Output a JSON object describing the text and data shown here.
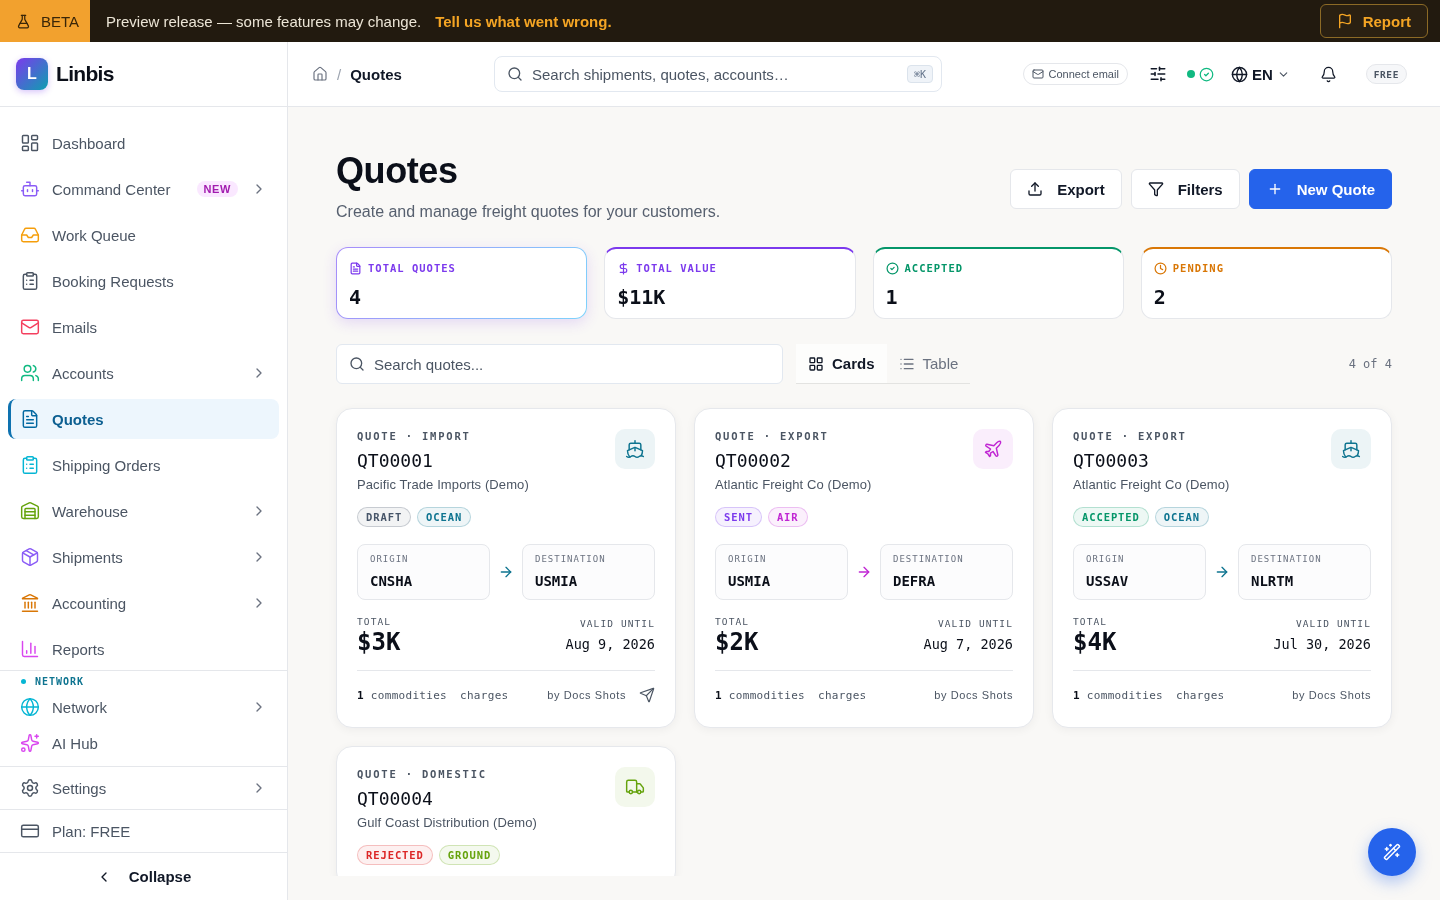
{
  "banner": {
    "badge": "BETA",
    "message": "Preview release — some features may change.",
    "link": "Tell us what went wrong.",
    "button": "Report"
  },
  "sidebar": {
    "brand": {
      "logo_letter": "L",
      "name": "Linbis"
    },
    "nav": [
      {
        "label": "Dashboard",
        "selected": false,
        "has_submenu": false
      },
      {
        "label": "Command Center",
        "selected": false,
        "has_submenu": true,
        "badge": "NEW"
      },
      {
        "label": "Work Queue",
        "selected": false,
        "has_submenu": false
      },
      {
        "label": "Booking Requests",
        "selected": false,
        "has_submenu": false
      },
      {
        "label": "Emails",
        "selected": false,
        "has_submenu": false
      },
      {
        "label": "Accounts",
        "selected": false,
        "has_submenu": true
      },
      {
        "label": "Quotes",
        "selected": true,
        "has_submenu": false
      },
      {
        "label": "Shipping Orders",
        "selected": false,
        "has_submenu": false
      },
      {
        "label": "Warehouse",
        "selected": false,
        "has_submenu": true
      },
      {
        "label": "Shipments",
        "selected": false,
        "has_submenu": true
      },
      {
        "label": "Accounting",
        "selected": false,
        "has_submenu": true
      },
      {
        "label": "Reports",
        "selected": false,
        "has_submenu": false
      }
    ],
    "network_section": {
      "title": "NETWORK",
      "items": [
        {
          "label": "Network",
          "selected": false,
          "has_submenu": true
        },
        {
          "label": "AI Hub",
          "selected": false,
          "has_submenu": false
        }
      ]
    },
    "settings": {
      "label": "Settings",
      "selected": false,
      "has_submenu": true
    },
    "plan": {
      "label": "Plan: FREE",
      "selected": false,
      "has_submenu": false
    },
    "collapse": "Collapse"
  },
  "header": {
    "breadcrumb": {
      "separator": "/",
      "current": "Quotes"
    },
    "search": {
      "placeholder": "Search shipments, quotes, accounts…",
      "shortcut": "⌘K"
    },
    "connect_email": "Connect email",
    "connected": true,
    "language": "EN",
    "plan_badge": "FREE"
  },
  "page": {
    "title": "Quotes",
    "subtitle": "Create and manage freight quotes for your customers.",
    "actions": [
      {
        "label": "Export",
        "kind": "secondary"
      },
      {
        "label": "Filters",
        "kind": "secondary"
      },
      {
        "label": "New Quote",
        "kind": "primary"
      }
    ]
  },
  "stats": [
    {
      "label": "TOTAL QUOTES",
      "value": "4",
      "color": "#7c3aed",
      "selected": true
    },
    {
      "label": "TOTAL VALUE",
      "value": "$11K",
      "color": "#7c3aed",
      "selected": false
    },
    {
      "label": "ACCEPTED",
      "value": "1",
      "color": "#059669",
      "selected": false
    },
    {
      "label": "PENDING",
      "value": "2",
      "color": "#d97706",
      "selected": false
    }
  ],
  "toolbar": {
    "search_placeholder": "Search quotes...",
    "views": [
      {
        "label": "Cards",
        "selected": true
      },
      {
        "label": "Table",
        "selected": false
      }
    ],
    "count": "4 of 4"
  },
  "quotes": [
    {
      "type_line": "QUOTE · IMPORT",
      "number": "QT00001",
      "customer": "Pacific Trade Imports (Demo)",
      "status": {
        "label": "DRAFT",
        "color": "#475569"
      },
      "mode": {
        "kind": "ocean",
        "label": "OCEAN",
        "color": "#0e7490"
      },
      "origin": {
        "label": "ORIGIN",
        "code": "CNSHA"
      },
      "destination": {
        "label": "DESTINATION",
        "code": "USMIA"
      },
      "total_label": "TOTAL",
      "total": "$3K",
      "valid_label": "VALID UNTIL",
      "valid_until": "Aug 9, 2026",
      "commodities": "**1** commodities",
      "charges": "charges",
      "author": "by Docs Shots",
      "send_action": true
    },
    {
      "type_line": "QUOTE · EXPORT",
      "number": "QT00002",
      "customer": "Atlantic Freight Co (Demo)",
      "status": {
        "label": "SENT",
        "color": "#7c3aed"
      },
      "mode": {
        "kind": "air",
        "label": "AIR",
        "color": "#c026d3"
      },
      "origin": {
        "label": "ORIGIN",
        "code": "USMIA"
      },
      "destination": {
        "label": "DESTINATION",
        "code": "DEFRA"
      },
      "total_label": "TOTAL",
      "total": "$2K",
      "valid_label": "VALID UNTIL",
      "valid_until": "Aug 7, 2026",
      "commodities": "**1** commodities",
      "charges": "charges",
      "author": "by Docs Shots",
      "send_action": false
    },
    {
      "type_line": "QUOTE · EXPORT",
      "number": "QT00003",
      "customer": "Atlantic Freight Co (Demo)",
      "status": {
        "label": "ACCEPTED",
        "color": "#059669"
      },
      "mode": {
        "kind": "ocean",
        "label": "OCEAN",
        "color": "#0e7490"
      },
      "origin": {
        "label": "ORIGIN",
        "code": "USSAV"
      },
      "destination": {
        "label": "DESTINATION",
        "code": "NLRTM"
      },
      "total_label": "TOTAL",
      "total": "$4K",
      "valid_label": "VALID UNTIL",
      "valid_until": "Jul 30, 2026",
      "commodities": "**1** commodities",
      "charges": "charges",
      "author": "by Docs Shots",
      "send_action": false
    },
    {
      "type_line": "QUOTE · DOMESTIC",
      "number": "QT00004",
      "customer": "Gulf Coast Distribution (Demo)",
      "status": {
        "label": "REJECTED",
        "color": "#dc2626"
      },
      "mode": {
        "kind": "ground",
        "label": "GROUND",
        "color": "#65a30d"
      }
    }
  ]
}
